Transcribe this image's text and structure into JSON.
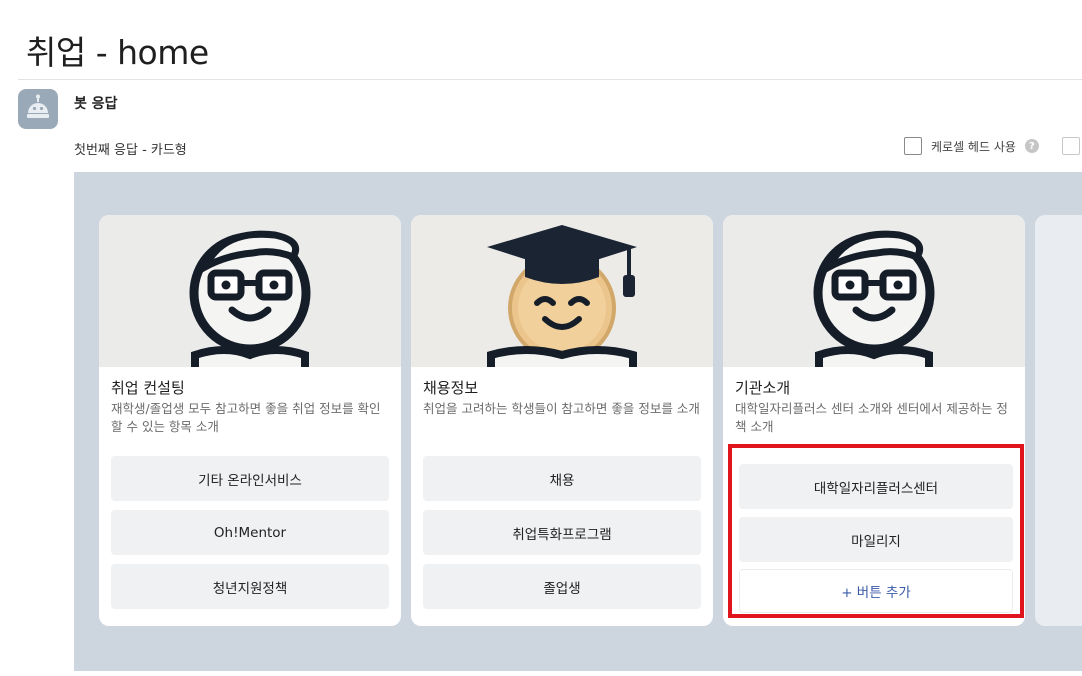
{
  "page": {
    "title": "취업 - home"
  },
  "bot": {
    "label": "봇 응답",
    "avatar_icon": "robot-icon"
  },
  "response": {
    "label": "첫번째 응답 - 카드형"
  },
  "options": {
    "carousel_head_label": "케로셀 헤드 사용",
    "help_icon": "question-circle-icon",
    "help_glyph": "?"
  },
  "colors": {
    "highlight": "#e0141c",
    "add_button_text": "#3a5aa8",
    "stage_bg": "#cdd6df"
  },
  "cards": [
    {
      "title": "취업 컨설팅",
      "description": "재학생/졸업생 모두 참고하면 좋을 취업 정보를 확인할 수 있는 항목 소개",
      "image_icon": "student-with-glasses-illustration",
      "buttons": [
        "기타 온라인서비스",
        "Oh!Mentor",
        "청년지원정책"
      ]
    },
    {
      "title": "채용정보",
      "description": "취업을 고려하는 학생들이 참고하면 좋을 정보를 소개",
      "image_icon": "graduate-cap-illustration",
      "buttons": [
        "채용",
        "취업특화프로그램",
        "졸업생"
      ]
    },
    {
      "title": "기관소개",
      "description": "대학일자리플러스 센터 소개와 센터에서 제공하는 정책 소개",
      "image_icon": "student-with-glasses-illustration",
      "buttons": [
        "대학일자리플러스센터",
        "마일리지"
      ],
      "add_button": "+ 버튼 추가"
    }
  ]
}
